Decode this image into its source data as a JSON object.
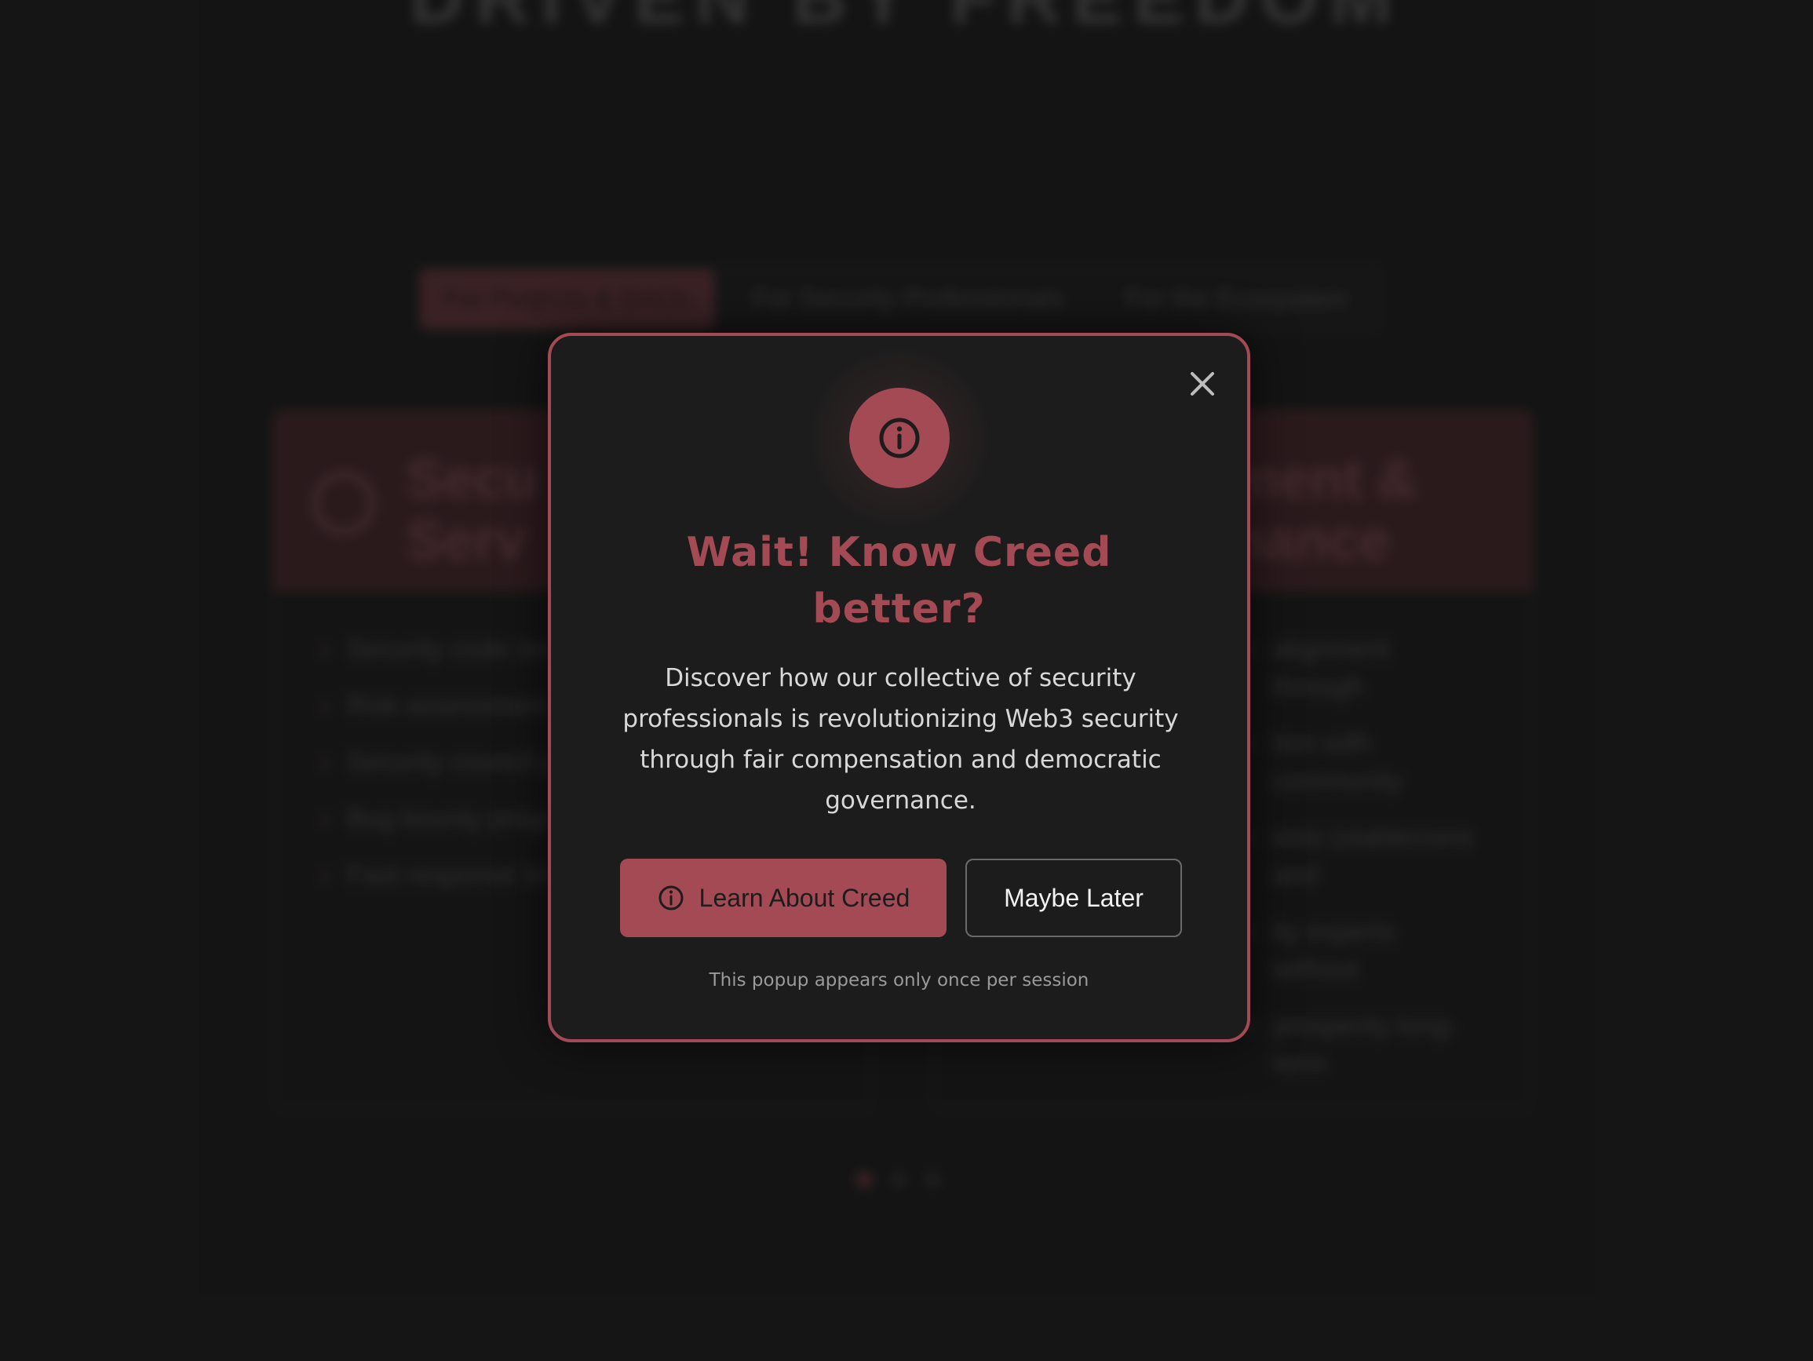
{
  "background": {
    "hero_title": "DRIVEN BY FREEDOM",
    "tabs": [
      {
        "label": "For Projects & DAOs",
        "active": true
      },
      {
        "label": "For Security Professionals",
        "active": false
      },
      {
        "label": "For the Ecosystem",
        "active": false
      }
    ],
    "cards": [
      {
        "title_line1": "Secu",
        "title_line2": "Serv",
        "items": [
          "Security code rev Pipeline",
          "Risk assessment and governance",
          "Security council p guidance",
          "Bug bounty progra",
          "Fast response tim needs"
        ]
      },
      {
        "title_line1": "ment &",
        "title_line2": "nance",
        "items": [
          "alignment through",
          "tion with community",
          "ents (stablecoins and",
          "ity experts without",
          "prosperity long-term"
        ]
      }
    ],
    "carousel_dots": 3
  },
  "modal": {
    "icon": "info-icon",
    "close_icon": "close-icon",
    "title_line1": "Wait! Know Creed",
    "title_line2": "better?",
    "body_line1": "Discover how our collective of security",
    "body_line2": "professionals is revolutionizing Web3 security",
    "body_line3": "through fair compensation and democratic",
    "body_line4": "governance.",
    "primary_button": "Learn About Creed",
    "secondary_button": "Maybe Later",
    "footnote": "This popup appears only once per session"
  },
  "colors": {
    "accent": "#a34a55",
    "background": "#1a1a1a",
    "modal_bg": "#1c1c1c"
  }
}
